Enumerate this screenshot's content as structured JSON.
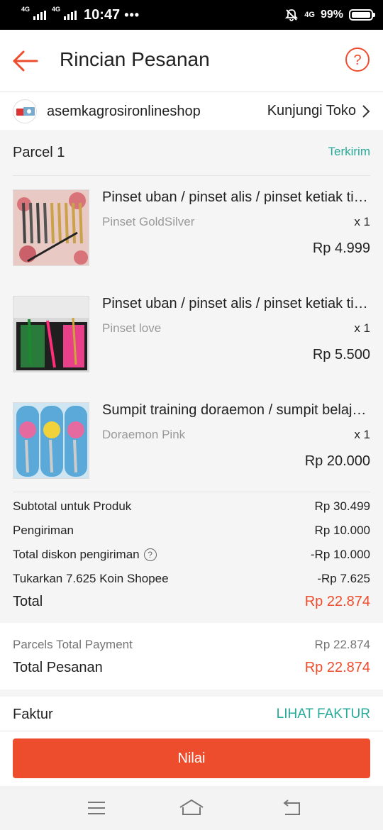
{
  "status_bar": {
    "network1": "4G",
    "network2": "4G",
    "time": "10:47",
    "dots": "•••",
    "network3": "4G",
    "battery": "99%"
  },
  "header": {
    "title": "Rincian Pesanan"
  },
  "shop": {
    "name": "asemkagrosironlineshop",
    "visit_label": "Kunjungi Toko"
  },
  "parcel": {
    "title": "Parcel 1",
    "status": "Terkirim"
  },
  "items": [
    {
      "name": "Pinset uban / pinset alis / pinset ketiak tidak",
      "variant": "Pinset GoldSilver",
      "qty": "x 1",
      "price": "Rp 4.999"
    },
    {
      "name": "Pinset uban / pinset alis / pinset ketiak tidak",
      "variant": "Pinset love",
      "qty": "x 1",
      "price": "Rp 5.500"
    },
    {
      "name": "Sumpit training doraemon / sumpit belajar anak",
      "variant": "Doraemon Pink",
      "qty": "x 1",
      "price": "Rp 20.000"
    }
  ],
  "summary": {
    "subtotal_label": "Subtotal untuk Produk",
    "subtotal_value": "Rp 30.499",
    "shipping_label": "Pengiriman",
    "shipping_value": "Rp 10.000",
    "ship_discount_label": "Total diskon pengiriman",
    "ship_discount_value": "-Rp 10.000",
    "coins_label": "Tukarkan 7.625 Koin Shopee",
    "coins_value": "-Rp 7.625",
    "total_label": "Total",
    "total_value": "Rp 22.874"
  },
  "payment": {
    "parcels_label": "Parcels Total Payment",
    "parcels_value": "Rp 22.874",
    "order_total_label": "Total Pesanan",
    "order_total_value": "Rp 22.874"
  },
  "invoice": {
    "label": "Faktur",
    "action": "LIHAT FAKTUR"
  },
  "action_button": "Nilai",
  "colors": {
    "accent": "#ee4d2d",
    "teal": "#26aa99"
  }
}
